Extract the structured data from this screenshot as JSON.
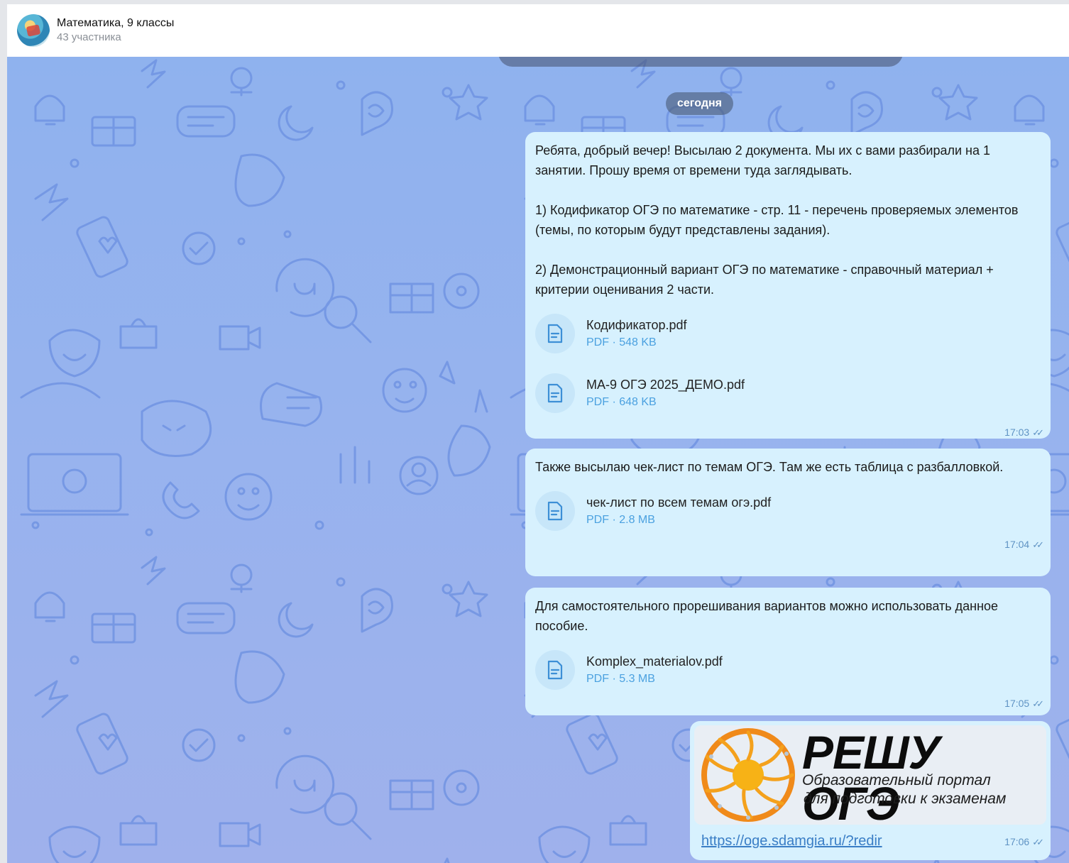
{
  "header": {
    "title": "Математика, 9 классы",
    "subtitle": "43 участника"
  },
  "chat": {
    "date_label": "сегодня",
    "messages": [
      {
        "paragraphs": [
          "Ребята, добрый вечер! Высылаю 2 документа. Мы их с вами разбирали на 1 занятии. Прошу время от времени туда заглядывать.",
          "1) Кодификатор ОГЭ по математике - стр. 11 - перечень проверяемых элементов (темы, по которым будут представлены задания).",
          "2) Демонстрационный вариант ОГЭ по математике - справочный материал + критерии оценивания 2 части."
        ],
        "files": [
          {
            "name": "Кодификатор.pdf",
            "meta": "PDF · 548 KB"
          },
          {
            "name": "МА-9 ОГЭ 2025_ДЕМО.pdf",
            "meta": "PDF · 648 KB"
          }
        ],
        "time": "17:03"
      },
      {
        "paragraphs": [
          "Также высылаю чек-лист по темам ОГЭ. Там же есть таблица с разбалловкой."
        ],
        "files": [
          {
            "name": "чек-лист по всем темам огэ.pdf",
            "meta": "PDF · 2.8 MB"
          }
        ],
        "time": "17:04"
      },
      {
        "paragraphs": [
          "Для самостоятельного прорешивания вариантов можно использовать данное пособие."
        ],
        "files": [
          {
            "name": "Komplex_materialov.pdf",
            "meta": "PDF · 5.3 MB"
          }
        ],
        "time": "17:05"
      }
    ],
    "link_message": {
      "banner_title": "РЕШУ ОГЭ",
      "banner_line1": "Образовательный портал",
      "banner_line2": "для подготовки к экзаменам",
      "url": "https://oge.sdamgia.ru/?redir",
      "time": "17:06"
    }
  },
  "icons": {
    "file": "document-icon",
    "read_status": "double-check-icon",
    "pattern": "doodle-wallpaper"
  },
  "colors": {
    "bubble": "#d7f1fe",
    "accent": "#4ba1e0",
    "wallpaper": "#8fb2ee"
  }
}
